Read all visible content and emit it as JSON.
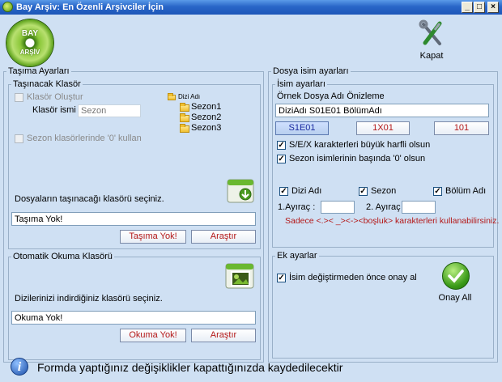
{
  "window": {
    "title": "Bay Arşiv: En Özenli Arşivciler İçin",
    "min_glyph": "_",
    "max_glyph": "□",
    "close_glyph": "×"
  },
  "logo": {
    "line1": "BAY",
    "line2": "ARŞİV"
  },
  "toolbar": {
    "close_label": "Kapat"
  },
  "tasima": {
    "legend": "Taşıma Ayarları",
    "folder_group": {
      "legend": "Taşınacak Klasör",
      "create_folder_label": "Klasör Oluştur",
      "folder_name_label": "Klasör ismi :",
      "folder_name_placeholder": "Sezon",
      "zero_label": "Sezon klasörlerinde '0' kullan",
      "tree_root": "Dizi Adı",
      "tree_children": [
        "Sezon1",
        "Sezon2",
        "Sezon3"
      ],
      "choose_label": "Dosyaların taşınacağı klasörü seçiniz.",
      "path_value": "Taşıma Yok!",
      "none_button": "Taşıma Yok!",
      "browse_button": "Araştır"
    },
    "read_group": {
      "legend": "Otomatik Okuma Klasörü",
      "choose_label": "Dizilerinizi indirdiğiniz klasörü seçiniz.",
      "path_value": "Okuma Yok!",
      "none_button": "Okuma Yok!",
      "browse_button": "Araştır"
    }
  },
  "dosya": {
    "legend": "Dosya isim ayarları",
    "name_group": {
      "legend": "İsim ayarları",
      "preview_label": "Örnek Dosya Adı Önizleme",
      "preview_value": "DiziAdı S01E01 BölümAdı",
      "format_buttons": [
        "S1E01",
        "1X01",
        "101"
      ],
      "upper_label": "S/E/X karakterleri büyük harfli olsun",
      "zero_label": "Sezon isimlerinin başında '0' olsun",
      "show_name": "Dizi Adı",
      "season": "Sezon",
      "episode_name": "Bölüm Adı",
      "sep1_label": "1.Ayıraç :",
      "sep2_label": "2. Ayıraç :",
      "warning": "Sadece <.>< _><-><boşluk> karakterleri  kullanabilirsiniz."
    },
    "extra_group": {
      "legend": "Ek ayarlar",
      "confirm_label": "İsim değiştirmeden önce onay al",
      "approve_all_label": "Onay All"
    }
  },
  "status": {
    "message": "Formda yaptığınız değişiklikler kapattığınızda kaydedilecektir"
  },
  "colors": {
    "background": "#cfe0f3",
    "titlebar": "#2966c8",
    "accent_red": "#b41818"
  }
}
